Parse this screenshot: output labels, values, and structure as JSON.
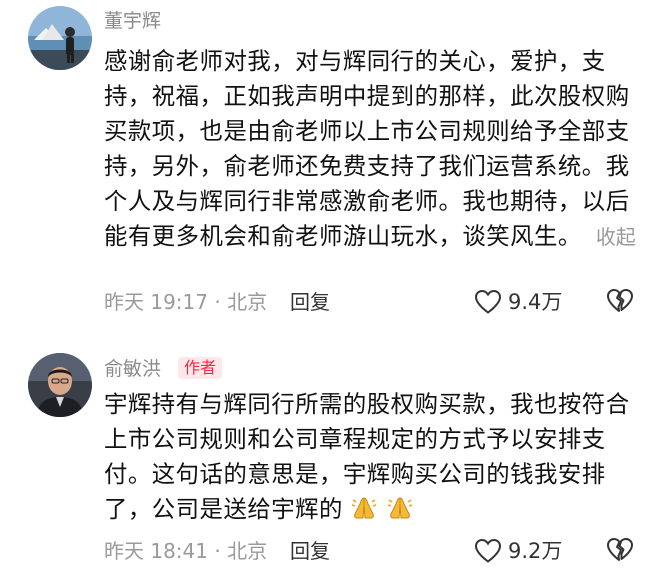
{
  "comments": [
    {
      "username": "董宇辉",
      "text": "感谢俞老师对我，对与辉同行的关心，爱护，支持，祝福，正如我声明中提到的那样，此次股权购买款项，也是由俞老师以上市公司规则给予全部支持，另外，俞老师还免费支持了我们运营系统。我个人及与辉同行非常感激俞老师。我也期待，以后能有更多机会和俞老师游山玩水，谈笑风生。",
      "collapse_label": "收起",
      "time": "昨天 19:17 · 北京",
      "reply_label": "回复",
      "like_count": "9.4万"
    },
    {
      "username": "俞敏洪",
      "badge": "作者",
      "text": "宇辉持有与辉同行所需的股权购买款，我也按符合上市公司规则和公司章程规定的方式予以安排支付。这句话的意思是，宇辉购买公司的钱我安排了，公司是送给宇辉的",
      "time": "昨天 18:41 · 北京",
      "reply_label": "回复",
      "like_count": "9.2万"
    }
  ],
  "icons": {
    "like": "heart-outline-icon",
    "dislike": "broken-heart-icon",
    "emoji": "folded-hands-emoji"
  },
  "colors": {
    "badge_bg": "#ffe8ea",
    "badge_text": "#ff2442",
    "meta_text": "#9a9a9a"
  }
}
